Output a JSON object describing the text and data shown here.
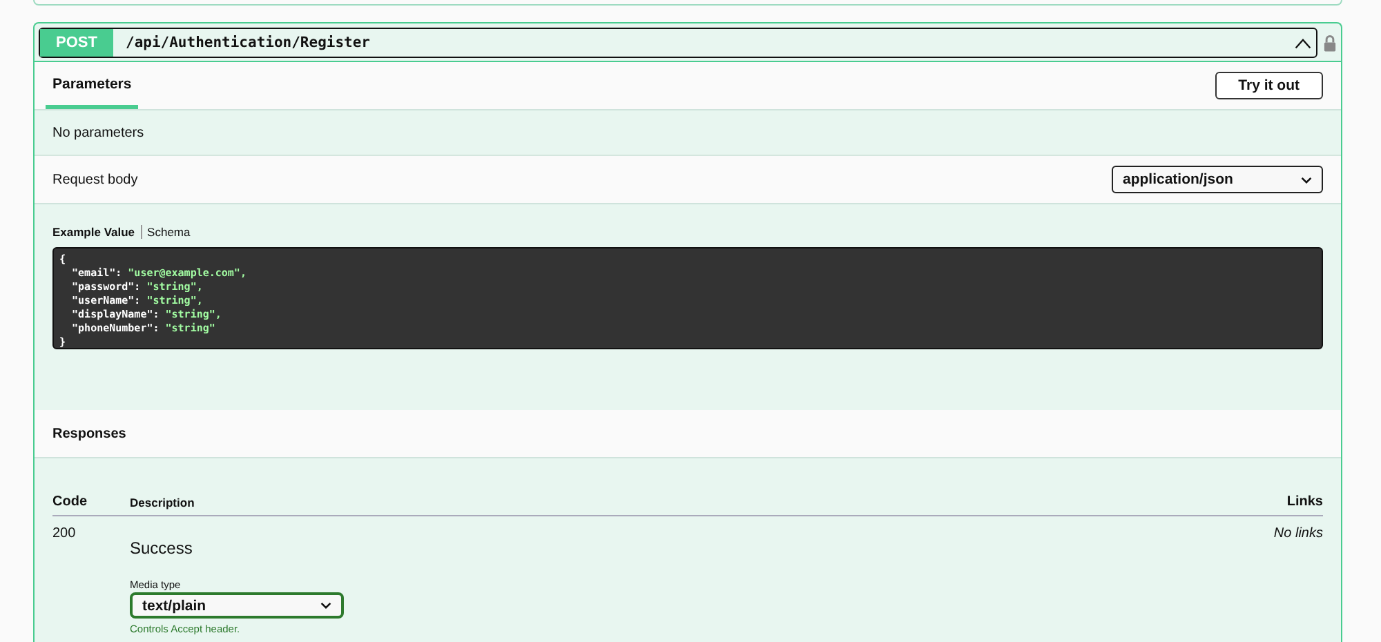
{
  "operation": {
    "method": "POST",
    "path": "/api/Authentication/Register",
    "expanded": true,
    "locked": true
  },
  "tabs": [
    {
      "label": "Parameters",
      "selected": true
    }
  ],
  "try_button": "Try it out",
  "parameters_note": "No parameters",
  "request_body": {
    "label": "Request body",
    "content_type": "application/json",
    "example_tabs": [
      {
        "label": "Example Value",
        "selected": true
      },
      {
        "label": "Schema",
        "selected": false
      }
    ],
    "example_lines": [
      {
        "key": "{"
      },
      {
        "key": "  \"email\":",
        "value": " \"user@example.com\","
      },
      {
        "key": "  \"password\":",
        "value": " \"string\","
      },
      {
        "key": "  \"userName\":",
        "value": " \"string\","
      },
      {
        "key": "  \"displayName\":",
        "value": " \"string\","
      },
      {
        "key": "  \"phoneNumber\":",
        "value": " \"string\""
      },
      {
        "key": "}"
      }
    ]
  },
  "responses": {
    "title": "Responses",
    "columns": [
      "Code",
      "Description",
      "Links"
    ],
    "rows": [
      {
        "code": "200",
        "description": "Success",
        "media_label": "Media type",
        "media_type": "text/plain",
        "media_hint": "Controls Accept header.",
        "links": "No links"
      }
    ]
  }
}
